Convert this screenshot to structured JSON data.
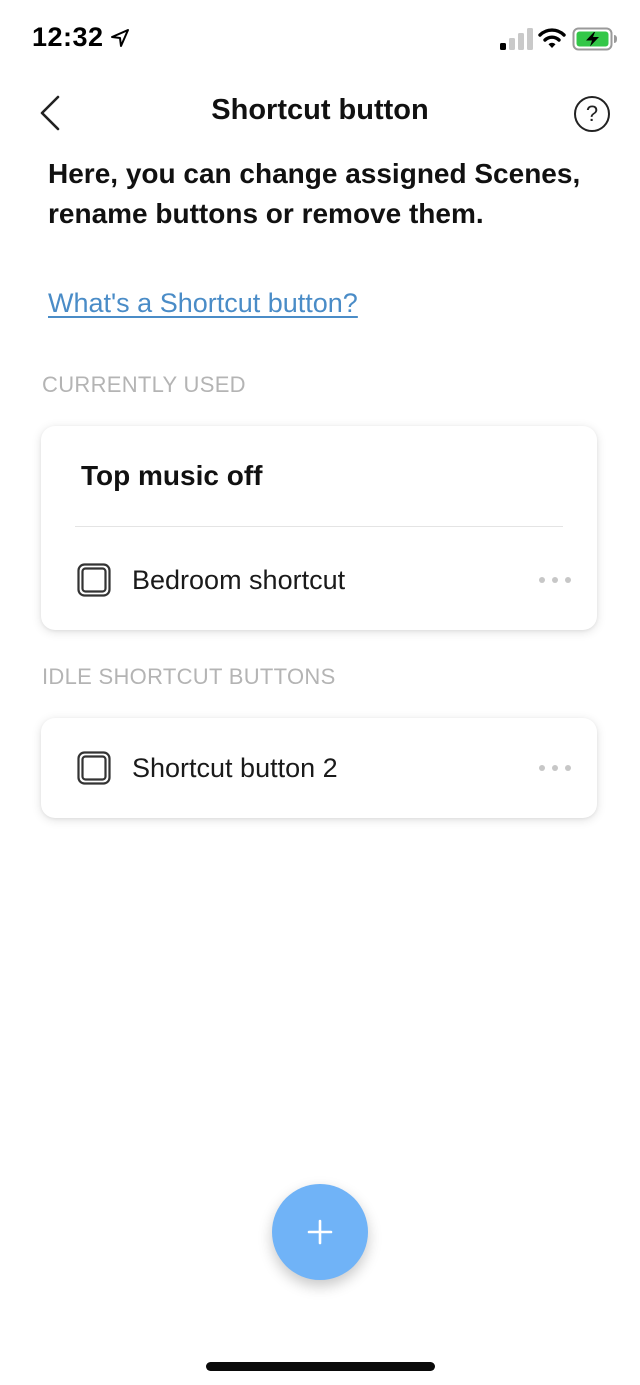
{
  "status_bar": {
    "time": "12:32",
    "icons": [
      "location-arrow-icon",
      "cellular-signal-icon",
      "wifi-icon",
      "battery-charging-icon"
    ],
    "battery_color": "#33c748"
  },
  "header": {
    "title": "Shortcut button",
    "back_icon": "chevron-left-icon",
    "help_label": "?"
  },
  "intro": {
    "text": "Here, you can change assigned Scenes, rename buttons or remove them.",
    "link": "What's a Shortcut button?",
    "link_color": "#4a8cc7"
  },
  "sections": {
    "currently_used": {
      "label": "CURRENTLY USED",
      "scene_title": "Top music off",
      "buttons": [
        {
          "label": "Bedroom shortcut",
          "icon": "shortcut-button-icon"
        }
      ]
    },
    "idle": {
      "label": "IDLE SHORTCUT BUTTONS",
      "buttons": [
        {
          "label": "Shortcut button 2",
          "icon": "shortcut-button-icon"
        }
      ]
    }
  },
  "fab": {
    "icon": "plus-icon",
    "color": "#70b3f7"
  }
}
